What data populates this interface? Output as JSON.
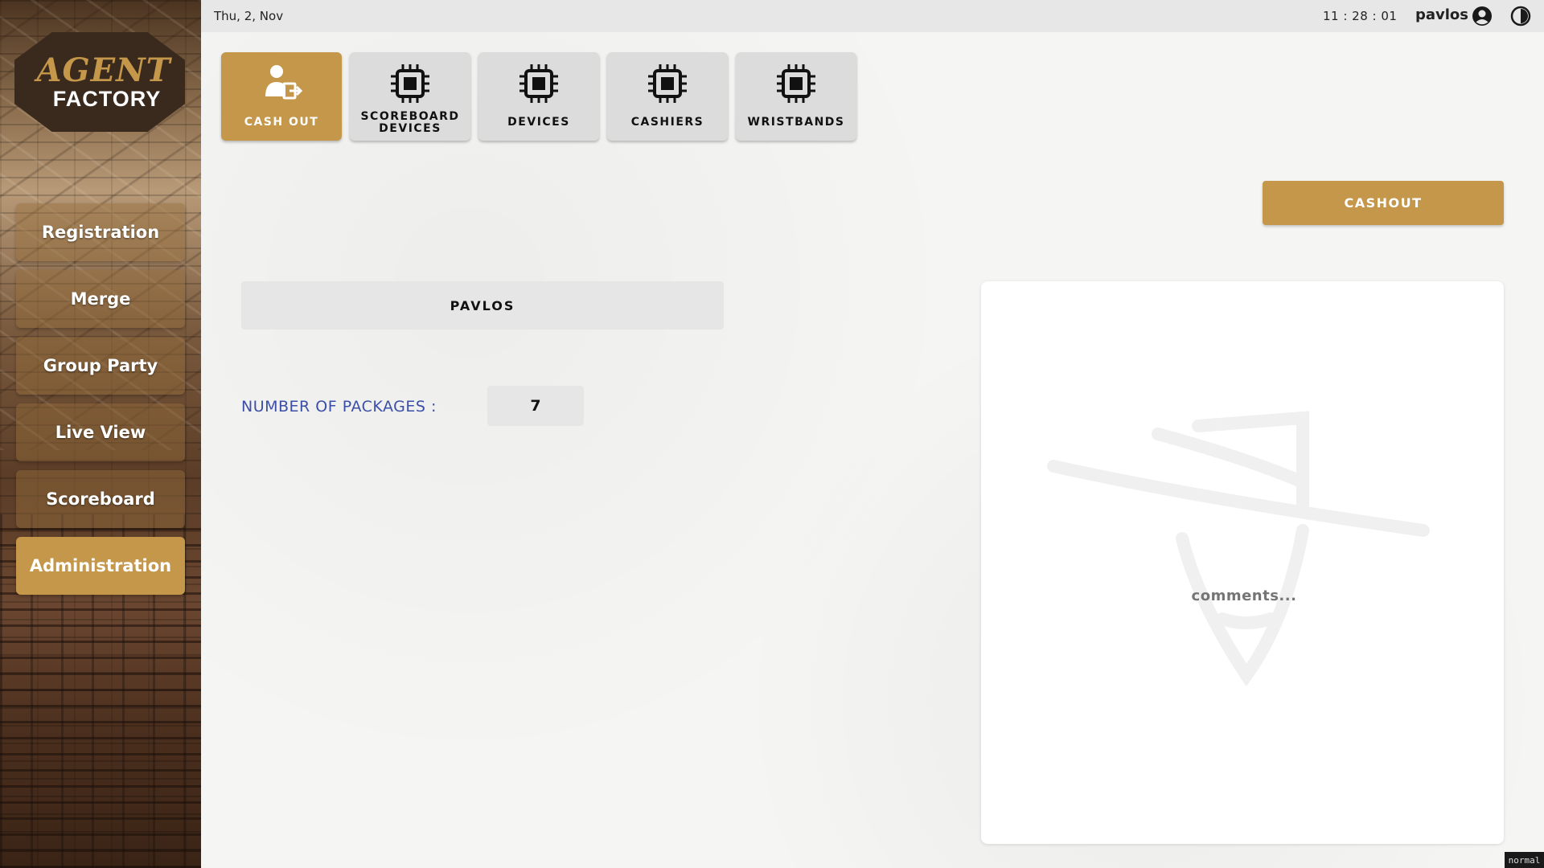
{
  "brand": {
    "line1": "AGENT",
    "line2": "FACTORY"
  },
  "sidebar": {
    "items": [
      {
        "label": "Registration",
        "active": false
      },
      {
        "label": "Merge",
        "active": false
      },
      {
        "label": "Group Party",
        "active": false
      },
      {
        "label": "Live View",
        "active": false
      },
      {
        "label": "Scoreboard",
        "active": false
      },
      {
        "label": "Administration",
        "active": true
      }
    ]
  },
  "topbar": {
    "date": "Thu, 2, Nov",
    "time": "11 : 28 : 01",
    "username": "pavlos",
    "icons": [
      "user-circle-icon",
      "theme-contrast-icon"
    ]
  },
  "tabs": [
    {
      "label": "CASH OUT",
      "icon": "user-exit-icon",
      "active": true
    },
    {
      "label_line1": "SCOREBOARD",
      "label_line2": "DEVICES",
      "icon": "chip-icon",
      "active": false
    },
    {
      "label": "DEVICES",
      "icon": "chip-icon",
      "active": false
    },
    {
      "label": "CASHIERS",
      "icon": "chip-icon",
      "active": false
    },
    {
      "label": "WRISTBANDS",
      "icon": "chip-icon",
      "active": false
    }
  ],
  "main": {
    "cashout_button": "CASHOUT",
    "player_name": "PAVLOS",
    "packages_label": "NUMBER OF PACKAGES :",
    "packages_value": "7",
    "comments_placeholder": "comments..."
  },
  "mode_tag": "normal",
  "colors": {
    "accent": "#c4974a",
    "label_blue": "#3b4fa8",
    "tab_bg": "#dcdcdc"
  }
}
